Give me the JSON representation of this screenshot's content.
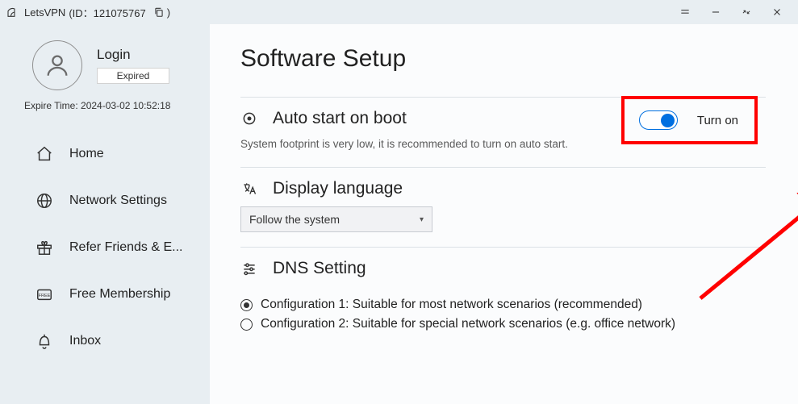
{
  "titlebar": {
    "app_name": "LetsVPN",
    "id_label": "(ID：121075767",
    "id_suffix": ")"
  },
  "sidebar": {
    "login_label": "Login",
    "status": "Expired",
    "expire_prefix": "Expire Time:",
    "expire_time": "2024-03-02 10:52:18",
    "items": [
      {
        "label": "Home"
      },
      {
        "label": "Network Settings"
      },
      {
        "label": "Refer Friends & E..."
      },
      {
        "label": "Free Membership"
      },
      {
        "label": "Inbox"
      }
    ]
  },
  "main": {
    "title": "Software Setup",
    "auto_start": {
      "title": "Auto start on boot",
      "desc": "System footprint is very low, it is recommended to turn on auto start.",
      "toggle_label": "Turn on"
    },
    "language": {
      "title": "Display language",
      "value": "Follow the system"
    },
    "dns": {
      "title": "DNS Setting",
      "opt1": "Configuration 1: Suitable for most network scenarios (recommended)",
      "opt2": "Configuration 2: Suitable for special network scenarios (e.g. office network)"
    }
  }
}
